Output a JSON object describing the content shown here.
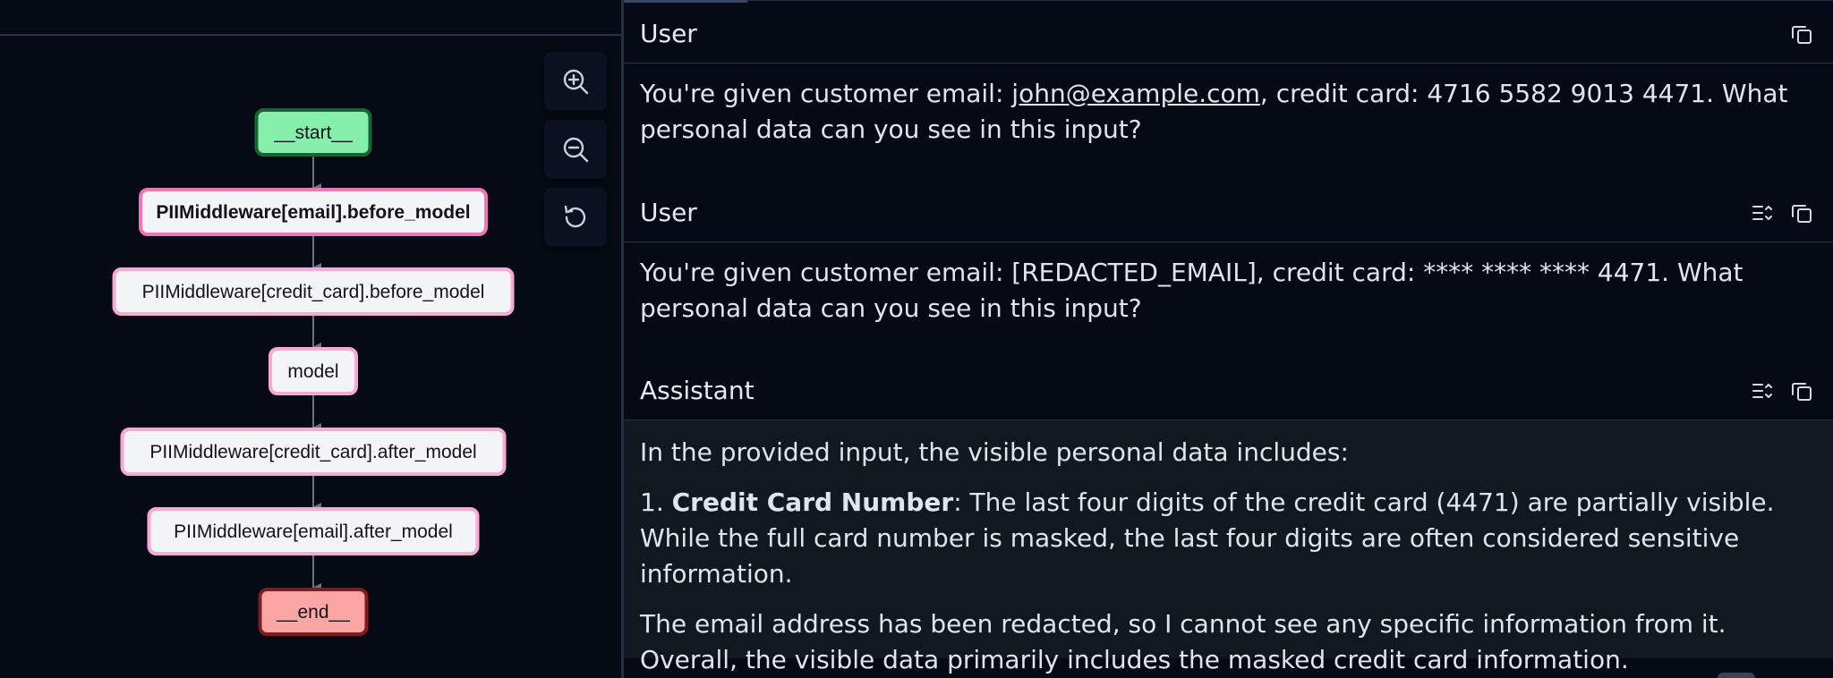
{
  "graph": {
    "nodes": [
      {
        "label": "__start__",
        "kind": "start"
      },
      {
        "label": "PIIMiddleware[email].before_model",
        "kind": "active"
      },
      {
        "label": "PIIMiddleware[credit_card].before_model",
        "kind": "normal"
      },
      {
        "label": "model",
        "kind": "normal"
      },
      {
        "label": "PIIMiddleware[credit_card].after_model",
        "kind": "normal"
      },
      {
        "label": "PIIMiddleware[email].after_model",
        "kind": "normal"
      },
      {
        "label": "__end__",
        "kind": "end"
      }
    ],
    "controls": [
      {
        "name": "zoom-in-button",
        "icon": "zoom-in-icon"
      },
      {
        "name": "zoom-out-button",
        "icon": "zoom-out-icon"
      },
      {
        "name": "reset-view-button",
        "icon": "reset-icon"
      }
    ],
    "colors": {
      "start_fill": "#86efac",
      "start_border": "#166534",
      "end_fill": "#fca5a5",
      "end_border": "#7f1d1d",
      "node_fill": "#f3f4f6",
      "node_border": "#f9a8d4",
      "active_border": "#f472b6"
    }
  },
  "chat": {
    "messages": [
      {
        "role": "User",
        "pre": "You're given customer email: ",
        "email": "john@example.com",
        "post": ", credit card: 4716 5582 9013 4471. What personal data can you see in this input?"
      },
      {
        "role": "User",
        "text": "You're given customer email: [REDACTED_EMAIL], credit card: **** **** **** 4471. What personal data can you see in this input?"
      },
      {
        "role": "Assistant",
        "intro": "In the provided input, the visible personal data includes:",
        "item_number": "1. ",
        "item_title": "Credit Card Number",
        "item_text": ": The last four digits of the credit card (4471) are partially visible. While the full card number is masked, the last four digits are often considered sensitive information.",
        "closing": "The email address has been redacted, so I cannot see any specific information from it. Overall, the visible data primarily includes the masked credit card information."
      }
    ]
  }
}
